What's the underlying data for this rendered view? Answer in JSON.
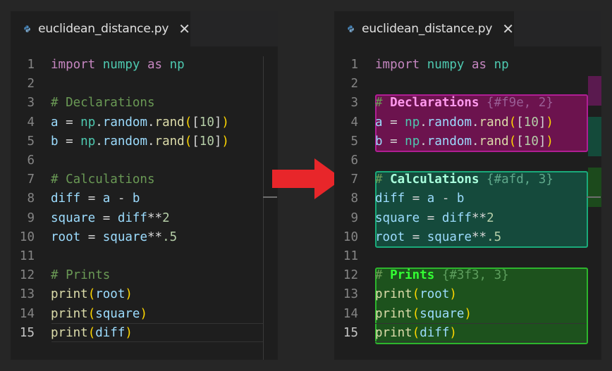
{
  "left_panel": {
    "tab_title": "euclidean_distance.py",
    "close_glyph": "✕",
    "lines": [
      {
        "n": "1",
        "tokens": [
          [
            "kw",
            "import"
          ],
          [
            "",
            " "
          ],
          [
            "mod",
            "numpy"
          ],
          [
            "",
            " "
          ],
          [
            "kw",
            "as"
          ],
          [
            "",
            " "
          ],
          [
            "mod",
            "np"
          ]
        ]
      },
      {
        "n": "2",
        "tokens": []
      },
      {
        "n": "3",
        "tokens": [
          [
            "cm",
            "# Declarations"
          ]
        ]
      },
      {
        "n": "4",
        "tokens": [
          [
            "var",
            "a"
          ],
          [
            "",
            " = "
          ],
          [
            "mod",
            "np"
          ],
          [
            "",
            "."
          ],
          [
            "var",
            "random"
          ],
          [
            "",
            "."
          ],
          [
            "fn",
            "rand"
          ],
          [
            "br",
            "("
          ],
          [
            "",
            "["
          ],
          [
            "num",
            "10"
          ],
          [
            "",
            "]"
          ],
          [
            "br",
            ")"
          ]
        ]
      },
      {
        "n": "5",
        "tokens": [
          [
            "var",
            "b"
          ],
          [
            "",
            " = "
          ],
          [
            "mod",
            "np"
          ],
          [
            "",
            "."
          ],
          [
            "var",
            "random"
          ],
          [
            "",
            "."
          ],
          [
            "fn",
            "rand"
          ],
          [
            "br",
            "("
          ],
          [
            "",
            "["
          ],
          [
            "num",
            "10"
          ],
          [
            "",
            "]"
          ],
          [
            "br",
            ")"
          ]
        ]
      },
      {
        "n": "6",
        "tokens": []
      },
      {
        "n": "7",
        "tokens": [
          [
            "cm",
            "# Calculations"
          ]
        ]
      },
      {
        "n": "8",
        "tokens": [
          [
            "var",
            "diff"
          ],
          [
            "",
            " = "
          ],
          [
            "var",
            "a"
          ],
          [
            "",
            " - "
          ],
          [
            "var",
            "b"
          ]
        ]
      },
      {
        "n": "9",
        "tokens": [
          [
            "var",
            "square"
          ],
          [
            "",
            " = "
          ],
          [
            "var",
            "diff"
          ],
          [
            "",
            "**"
          ],
          [
            "num",
            "2"
          ]
        ]
      },
      {
        "n": "10",
        "tokens": [
          [
            "var",
            "root"
          ],
          [
            "",
            " = "
          ],
          [
            "var",
            "square"
          ],
          [
            "",
            "**"
          ],
          [
            "num",
            ".5"
          ]
        ]
      },
      {
        "n": "11",
        "tokens": []
      },
      {
        "n": "12",
        "tokens": [
          [
            "cm",
            "# Prints"
          ]
        ]
      },
      {
        "n": "13",
        "tokens": [
          [
            "fn",
            "print"
          ],
          [
            "br",
            "("
          ],
          [
            "var",
            "root"
          ],
          [
            "br",
            ")"
          ]
        ]
      },
      {
        "n": "14",
        "tokens": [
          [
            "fn",
            "print"
          ],
          [
            "br",
            "("
          ],
          [
            "var",
            "square"
          ],
          [
            "br",
            ")"
          ]
        ]
      },
      {
        "n": "15",
        "tokens": [
          [
            "fn",
            "print"
          ],
          [
            "br",
            "("
          ],
          [
            "var",
            "diff"
          ],
          [
            "br",
            ")"
          ]
        ]
      }
    ]
  },
  "right_panel": {
    "tab_title": "euclidean_distance.py",
    "close_glyph": "✕",
    "regions": [
      {
        "name": "Declarations",
        "tag": "{#f9e, 2}",
        "color": "#ff99ee"
      },
      {
        "name": "Calculations",
        "tag": "{#afd, 3}",
        "color": "#aaffdd"
      },
      {
        "name": "Prints",
        "tag": "{#3f3, 3}",
        "color": "#33ff33"
      }
    ]
  },
  "arrow_color": "#e8262a",
  "icons": {
    "file": "python-file-icon",
    "close": "close-icon",
    "arrow": "right-arrow-icon"
  }
}
